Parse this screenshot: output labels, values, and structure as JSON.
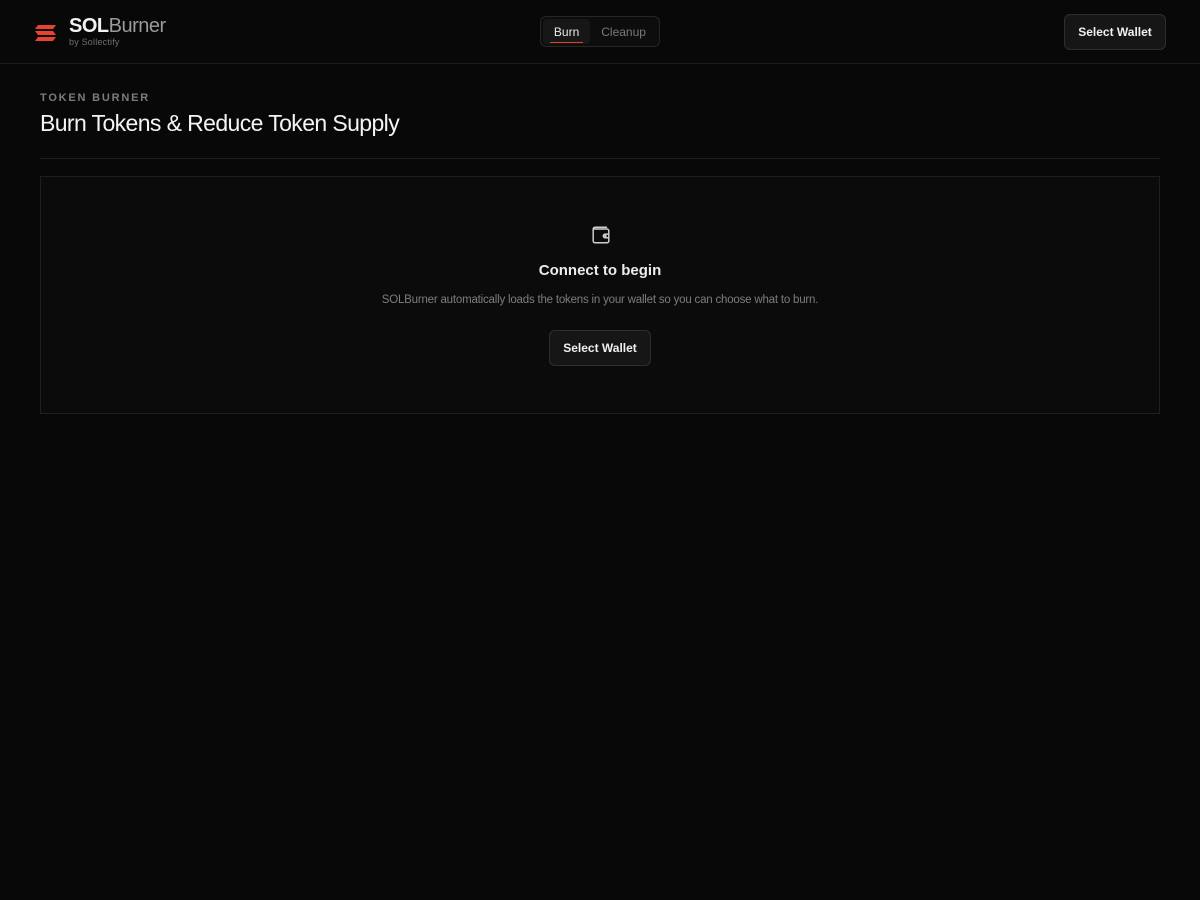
{
  "brand": {
    "name_bold": "SOL",
    "name_light": "Burner",
    "subtitle": "by Sollectify",
    "accent_color": "#e8432f"
  },
  "nav": {
    "tabs": [
      {
        "label": "Burn",
        "active": true
      },
      {
        "label": "Cleanup",
        "active": false
      }
    ]
  },
  "header": {
    "wallet_button": "Select Wallet"
  },
  "main": {
    "eyebrow": "TOKEN BURNER",
    "title": "Burn Tokens & Reduce Token Supply"
  },
  "connect_card": {
    "icon": "wallet-icon",
    "title": "Connect to begin",
    "description": "SOLBurner automatically loads the tokens in your wallet so you can choose what to burn.",
    "button": "Select Wallet"
  }
}
